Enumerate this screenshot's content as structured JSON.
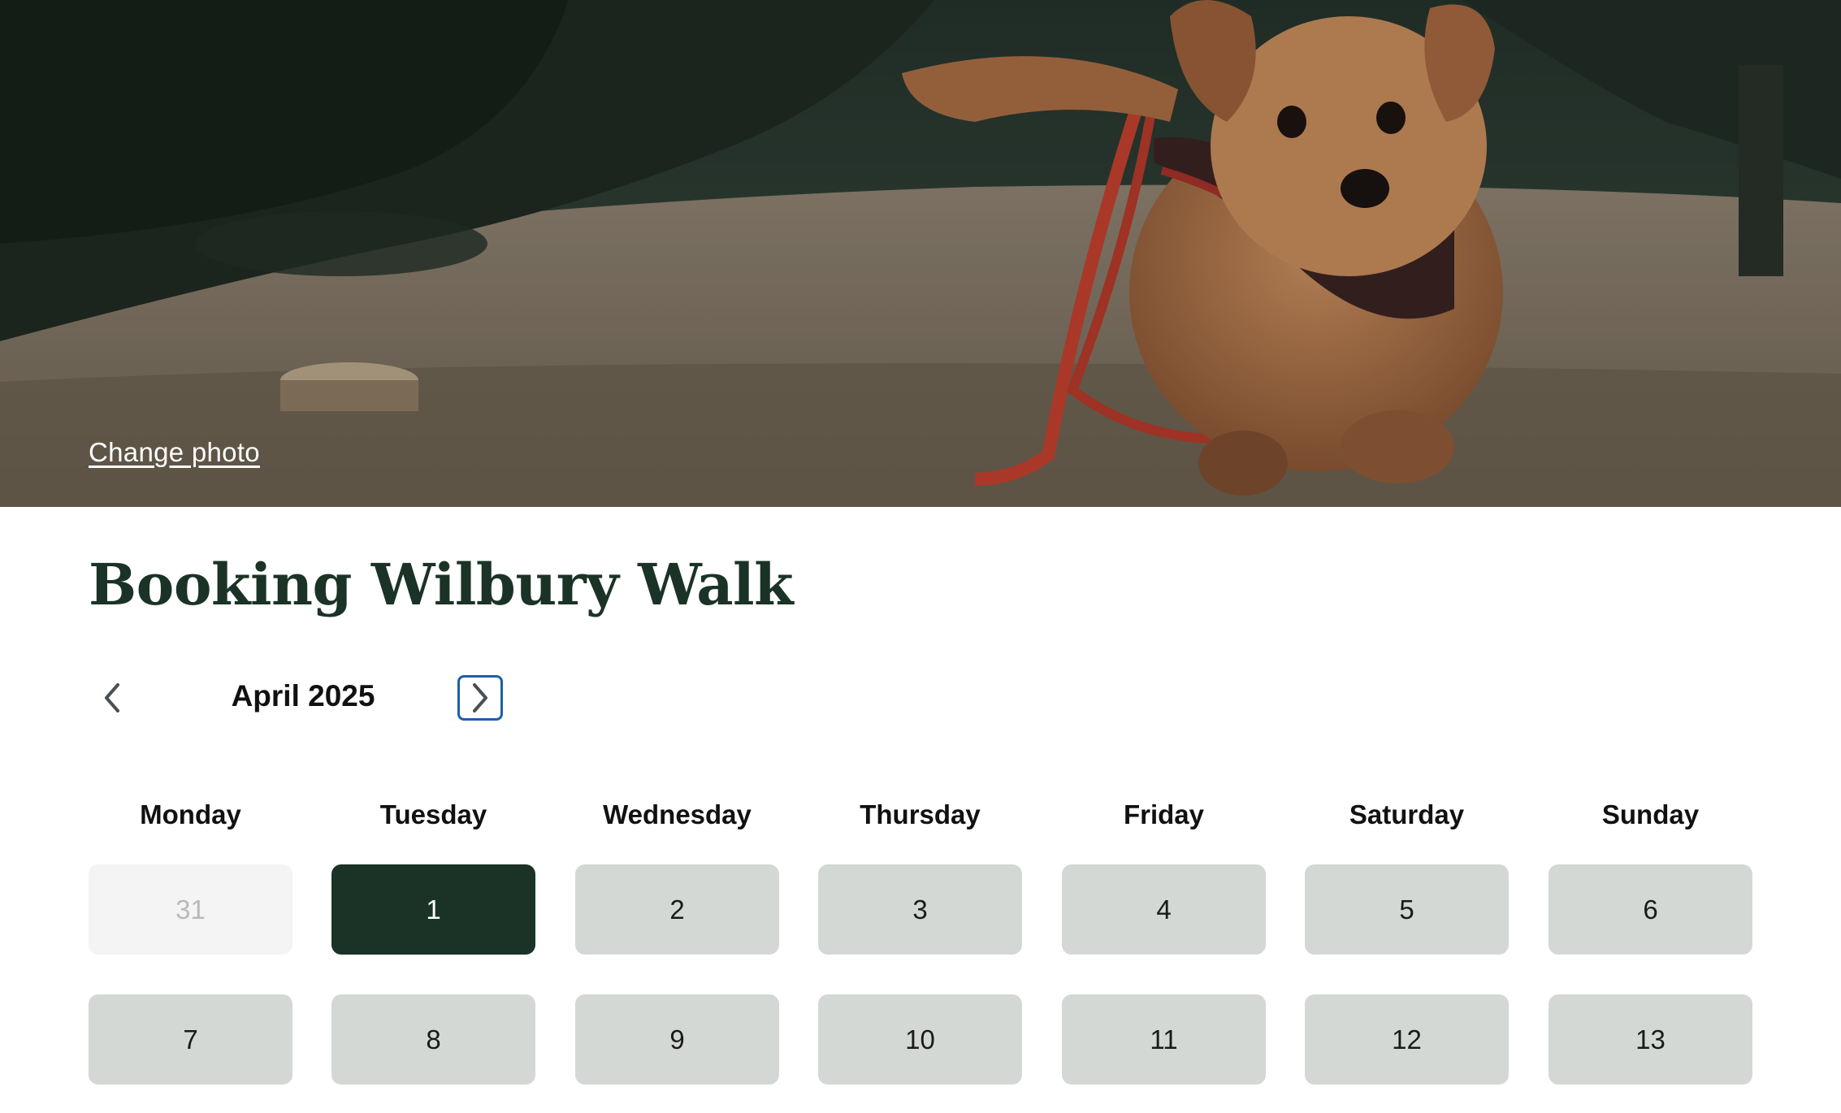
{
  "hero": {
    "change_photo_label": "Change photo"
  },
  "page": {
    "title": "Booking Wilbury Walk"
  },
  "calendar": {
    "month_label": "April 2025",
    "weekdays": [
      "Monday",
      "Tuesday",
      "Wednesday",
      "Thursday",
      "Friday",
      "Saturday",
      "Sunday"
    ],
    "weeks": [
      [
        "31",
        "1",
        "2",
        "3",
        "4",
        "5",
        "6"
      ],
      [
        "7",
        "8",
        "9",
        "10",
        "11",
        "12",
        "13"
      ]
    ],
    "selected_day": "1",
    "outside_month_day": "31"
  },
  "colors": {
    "brand_dark_green": "#1b3326",
    "day_default_bg": "#d4d8d5",
    "day_outside_bg": "#f4f4f4",
    "focus_outline": "#1f5fa8"
  },
  "icons": {
    "prev": "chevron-left-icon",
    "next": "chevron-right-icon"
  }
}
